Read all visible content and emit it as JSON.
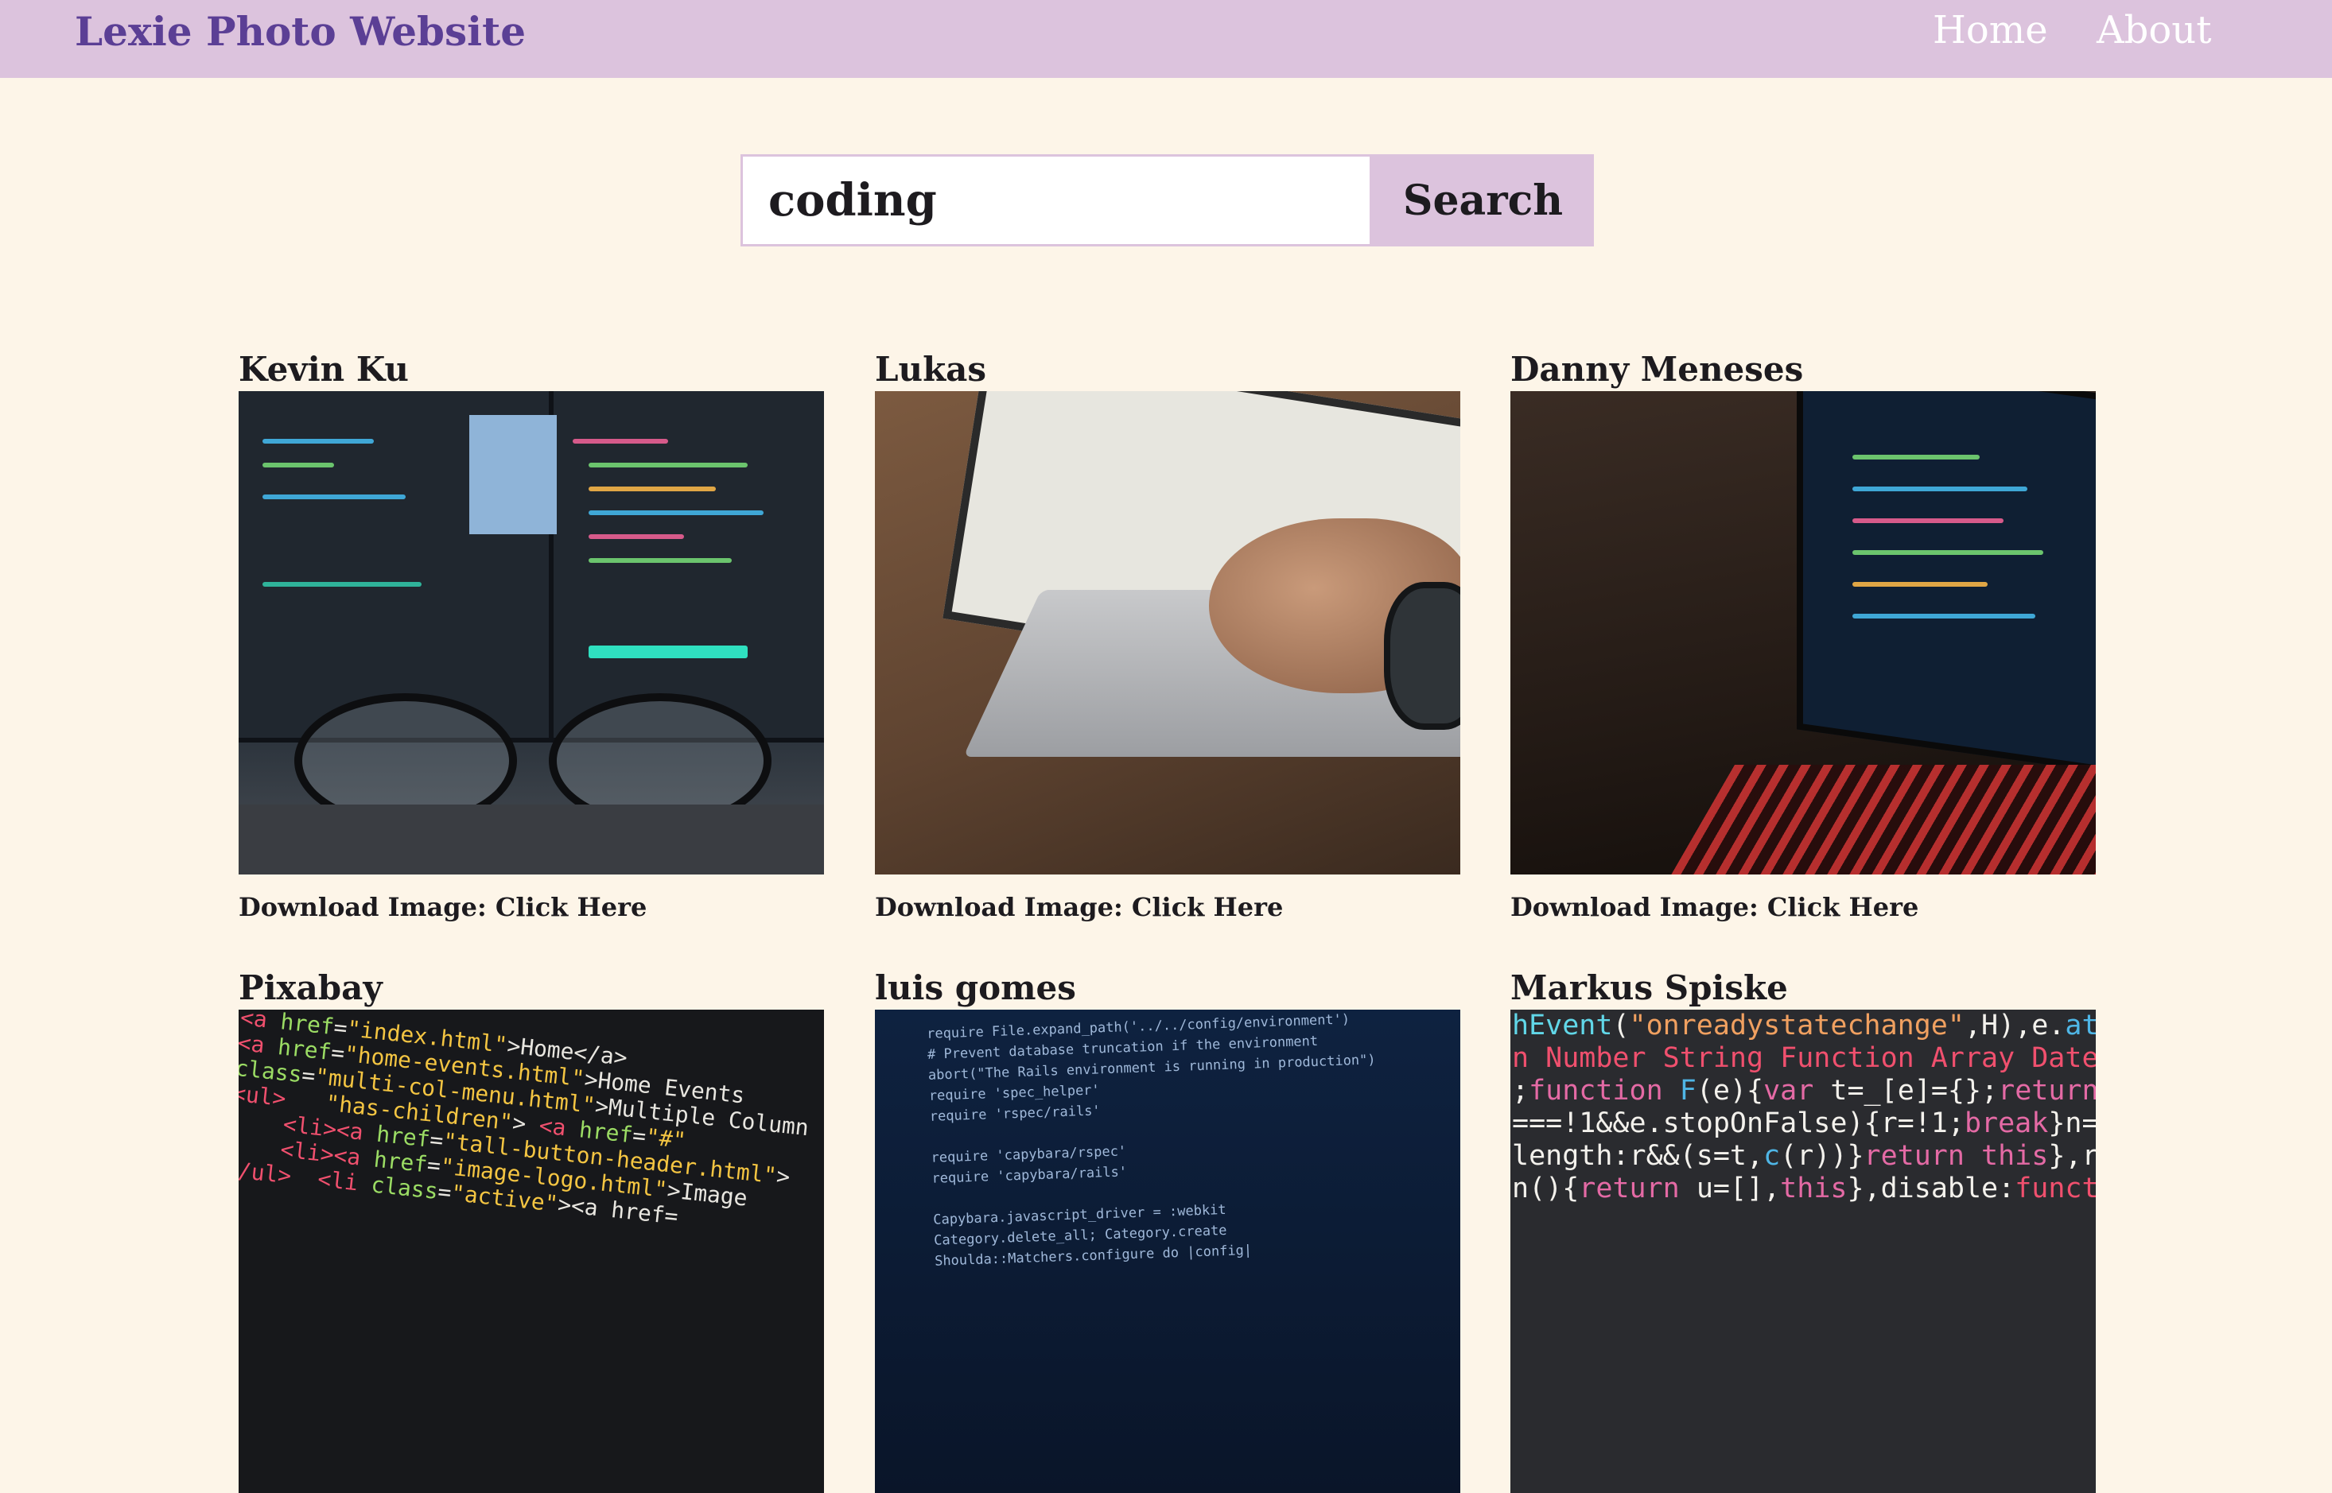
{
  "navbar": {
    "brand": "Lexie Photo Website",
    "links": [
      "Home",
      "About"
    ]
  },
  "search": {
    "value": "coding",
    "button_label": "Search"
  },
  "results": [
    {
      "photographer": "Kevin Ku",
      "download_label": "Download Image: Click Here"
    },
    {
      "photographer": "Lukas",
      "download_label": "Download Image: Click Here"
    },
    {
      "photographer": "Danny Meneses",
      "download_label": "Download Image: Click Here"
    },
    {
      "photographer": "Pixabay",
      "download_label": ""
    },
    {
      "photographer": "luis gomes",
      "download_label": ""
    },
    {
      "photographer": "Markus Spiske",
      "download_label": ""
    }
  ],
  "colors": {
    "page_bg": "#fdf5e8",
    "navbar_bg": "#dcc3dd",
    "brand": "#5b3f95",
    "nav_link": "#ffffff"
  }
}
